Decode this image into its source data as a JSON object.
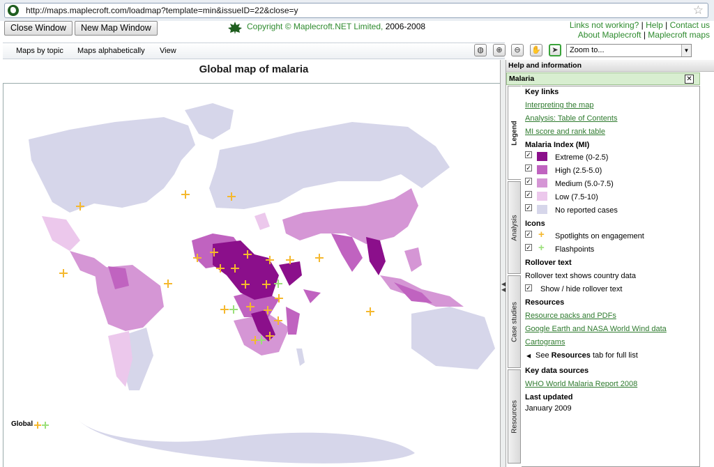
{
  "browser": {
    "url": "http://maps.maplecroft.com/loadmap?template=min&issueID=22&close=y"
  },
  "header": {
    "close_window": "Close Window",
    "new_map_window": "New Map Window",
    "copyright": "Copyright © Maplecroft.NET Limited,",
    "years": " 2006-2008",
    "links": {
      "not_working": "Links not working?",
      "help": "Help",
      "contact": "Contact us",
      "about": "About Maplecroft",
      "maps": "Maplecroft maps",
      "sep": "|"
    }
  },
  "menu": {
    "items": [
      "Maps by topic",
      "Maps alphabetically",
      "View"
    ],
    "zoom_placeholder": "Zoom to..."
  },
  "map": {
    "title": "Global map of malaria",
    "global_label": "Global",
    "colors": {
      "extreme": "#8b0f8b",
      "high": "#c063c0",
      "medium": "#d596d5",
      "low": "#ecc8ec",
      "none": "#d6d6ea",
      "spotlight": "#f5b82e",
      "flashpoint": "#9be07a"
    }
  },
  "panel": {
    "header": "Help and information",
    "subheader": "Malaria",
    "tabs": [
      "Legend",
      "Analysis",
      "Case studies",
      "Resources"
    ],
    "key_links": {
      "heading": "Key links",
      "items": [
        "Interpreting the map",
        "Analysis: Table of Contents",
        "MI score and rank table"
      ]
    },
    "index": {
      "heading": "Malaria Index (MI)",
      "items": [
        {
          "label": "Extreme (0-2.5)",
          "color": "#8b0f8b"
        },
        {
          "label": "High (2.5-5.0)",
          "color": "#c063c0"
        },
        {
          "label": "Medium (5.0-7.5)",
          "color": "#d596d5"
        },
        {
          "label": "Low (7.5-10)",
          "color": "#ecc8ec"
        },
        {
          "label": "No reported cases",
          "color": "#d6d6ea"
        }
      ]
    },
    "icons": {
      "heading": "Icons",
      "items": [
        "Spotlights on engagement",
        "Flashpoints"
      ]
    },
    "rollover": {
      "heading": "Rollover text",
      "desc": "Rollover text shows country data",
      "toggle": "Show / hide rollover text"
    },
    "resources": {
      "heading": "Resources",
      "items": [
        "Resource packs and PDFs",
        "Google Earth and NASA World Wind data",
        "Cartograms"
      ],
      "see_pre": "See ",
      "see_bold": "Resources",
      "see_post": " tab for full list"
    },
    "sources": {
      "heading": "Key data sources",
      "item": "WHO World Malaria Report 2008"
    },
    "updated": {
      "heading": "Last updated",
      "value": "January 2009"
    }
  }
}
